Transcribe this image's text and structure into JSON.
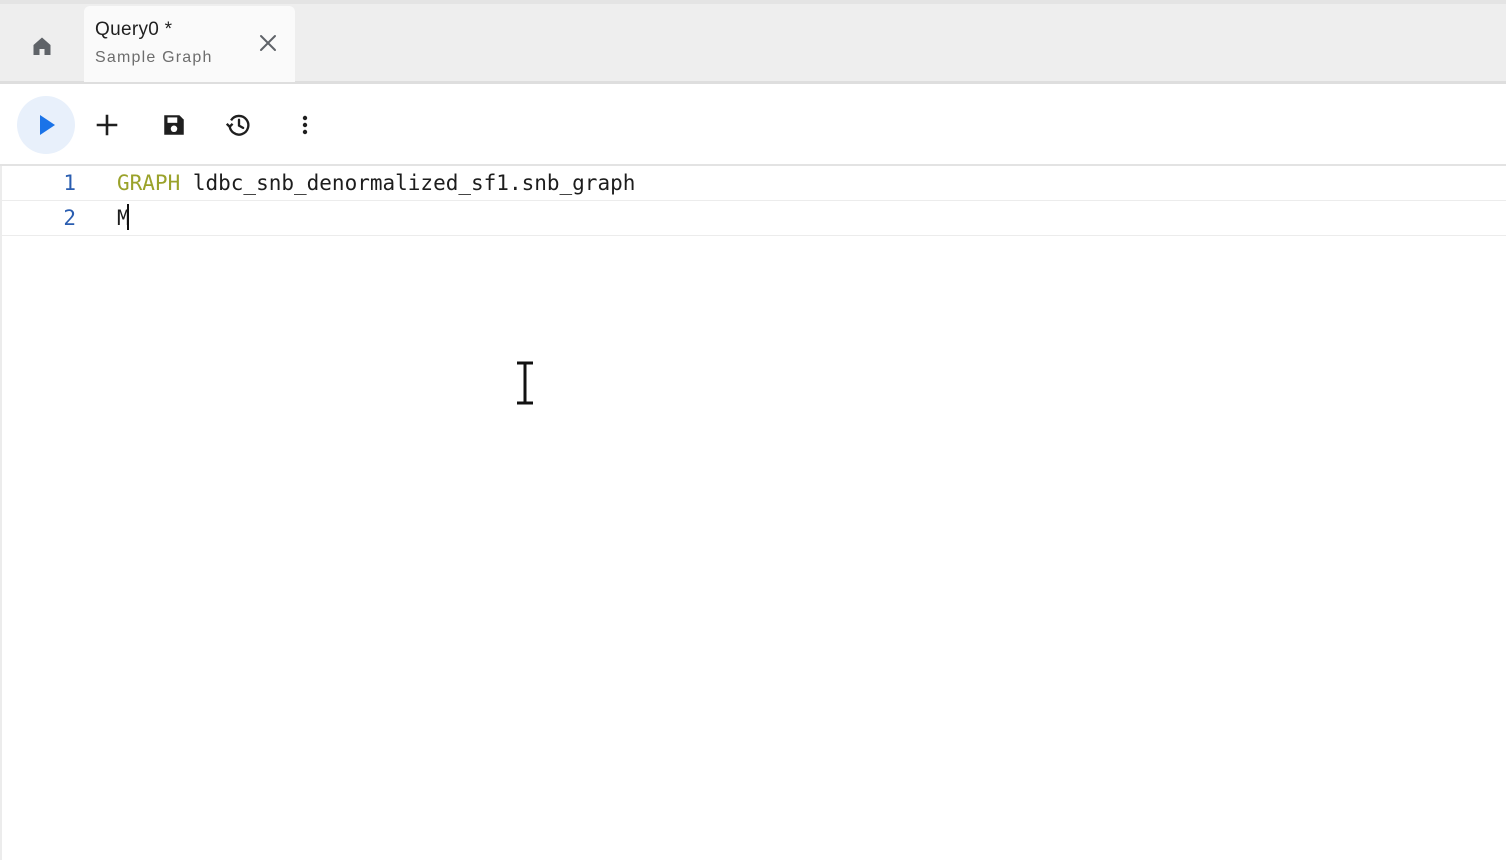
{
  "tabbar": {
    "home_icon": "home-icon",
    "tabs": [
      {
        "title": "Query0 *",
        "subtitle": "Sample Graph",
        "close_icon": "close-icon"
      }
    ]
  },
  "toolbar": {
    "run_icon": "play-icon",
    "add_icon": "plus-icon",
    "save_icon": "save-icon",
    "history_icon": "history-icon",
    "more_icon": "more-vertical-icon",
    "run_accent": "#1a73e8"
  },
  "editor": {
    "lines": [
      {
        "number": "1",
        "keyword": "GRAPH",
        "text": " ldbc_snb_denormalized_sf1.snb_graph"
      },
      {
        "number": "2",
        "keyword": "",
        "text": "M"
      }
    ]
  },
  "colors": {
    "keyword": "#9aa22a",
    "line_number": "#2a5db0",
    "tab_bg": "#fafafa",
    "tabbar_bg": "#eeeeee"
  }
}
